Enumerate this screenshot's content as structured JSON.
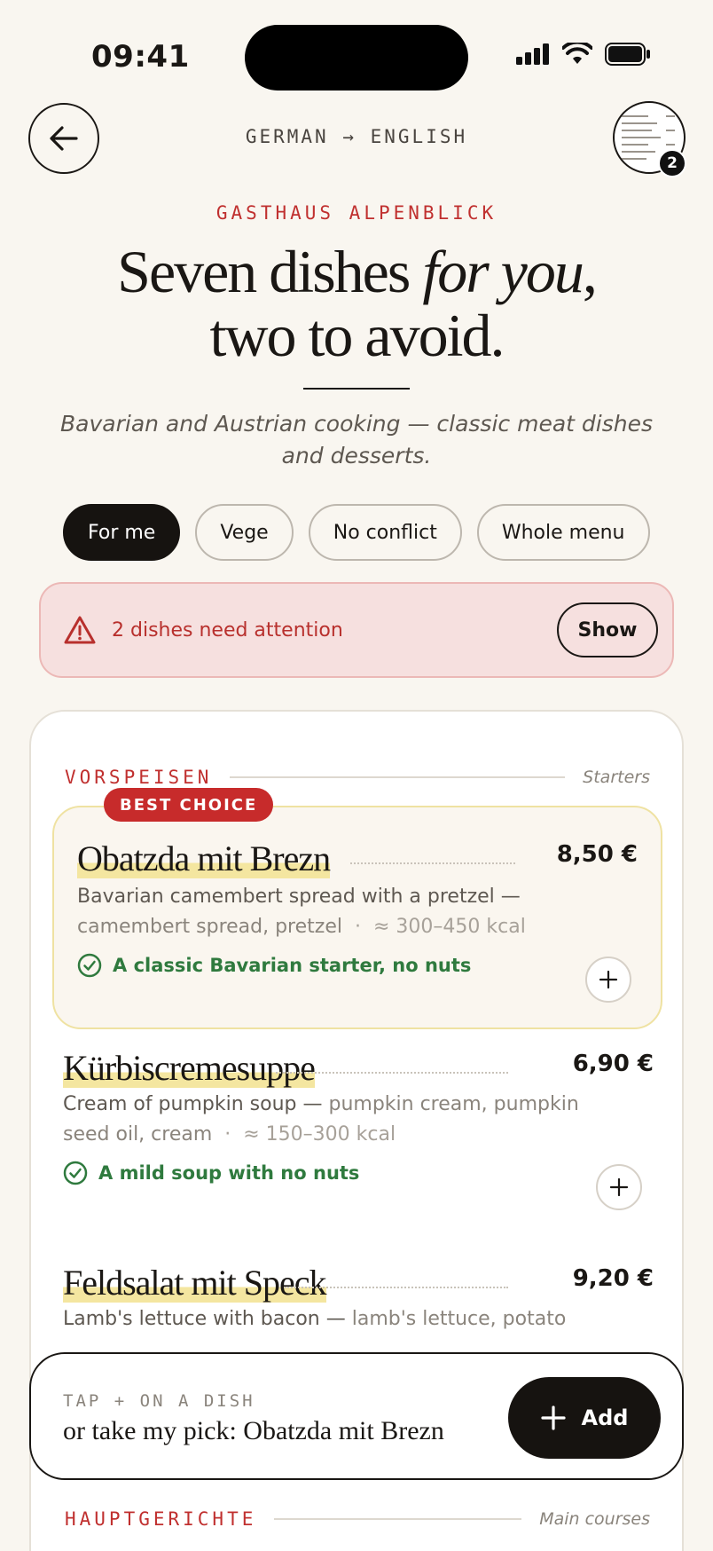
{
  "status_bar": {
    "time": "09:41"
  },
  "header": {
    "language_pair": "GERMAN → ENGLISH",
    "photo_count": "2"
  },
  "hero": {
    "restaurant": "GASTHAUS ALPENBLICK",
    "headline_part1": "Seven dishes ",
    "headline_emph": "for you",
    "headline_part2": ",",
    "headline_line2": "two to avoid.",
    "subtitle": "Bavarian and Austrian cooking — classic meat dishes and desserts."
  },
  "filters": [
    {
      "label": "For me",
      "active": true
    },
    {
      "label": "Vege",
      "active": false
    },
    {
      "label": "No conflict",
      "active": false
    },
    {
      "label": "Whole menu",
      "active": false
    }
  ],
  "alert": {
    "text": "2 dishes need attention",
    "button": "Show"
  },
  "sections": [
    {
      "title_de": "VORSPEISEN",
      "title_en": "Starters",
      "dishes": [
        {
          "badge": "BEST CHOICE",
          "name": "Obatzda mit Brezn",
          "price": "8,50 €",
          "description": "Bavarian camembert spread with a pretzel —",
          "ingredients": "camembert spread, pretzel",
          "kcal": "≈ 300–450 kcal",
          "note": "A classic Bavarian starter, no nuts"
        },
        {
          "name": "Kürbiscremesuppe",
          "price": "6,90 €",
          "description": "Cream of pumpkin soup —",
          "ingredients": "pumpkin cream, pumpkin seed oil, cream",
          "kcal": "≈ 150–300 kcal",
          "note": "A mild soup with no nuts"
        },
        {
          "name": "Feldsalat mit Speck",
          "price": "9,20 €",
          "description": "Lamb's lettuce with bacon —",
          "ingredients": "lamb's lettuce, potato"
        }
      ]
    },
    {
      "title_de": "HAUPTGERICHTE",
      "title_en": "Main courses"
    }
  ],
  "bottom_bar": {
    "hint": "TAP + ON A DISH",
    "pick": "or take my pick: Obatzda mit Brezn",
    "add_label": "Add"
  },
  "colors": {
    "accent_red": "#c0302f",
    "ok_green": "#2f7a3e",
    "highlight": "#f4e6a0",
    "dark": "#161310"
  }
}
